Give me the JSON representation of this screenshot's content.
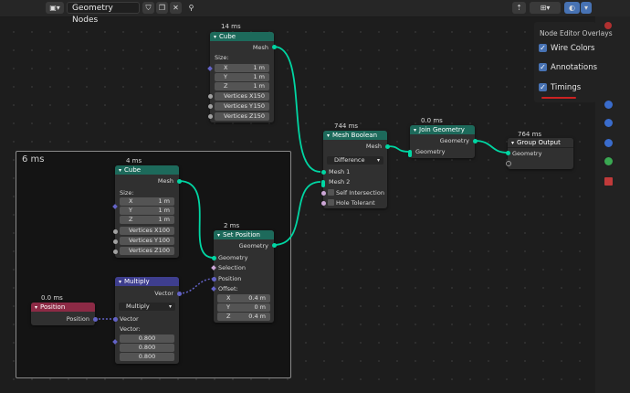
{
  "header": {
    "editor_type_icon": "node-editor-icon",
    "tree_name": "Geometry Nodes",
    "fake_user_icon": "shield-icon",
    "copy_icon": "duplicate-icon",
    "delete_icon": "x-icon",
    "pin_icon": "pin-icon"
  },
  "overlays": {
    "title": "Node Editor Overlays",
    "items": [
      {
        "label": "Wire Colors",
        "checked": true
      },
      {
        "label": "Annotations",
        "checked": true
      },
      {
        "label": "Timings",
        "checked": true
      }
    ],
    "check_mark": "✓",
    "accent_color": "#4772b3",
    "underline_color": "#cc2222"
  },
  "frame": {
    "label": "6 ms"
  },
  "nodes": {
    "cube_top": {
      "timing": "14 ms",
      "title": "Cube",
      "output": "Mesh",
      "size_label": "Size:",
      "fields": [
        {
          "label": "X",
          "value": "1 m"
        },
        {
          "label": "Y",
          "value": "1 m"
        },
        {
          "label": "Z",
          "value": "1 m"
        },
        {
          "label": "Vertices X",
          "value": "150"
        },
        {
          "label": "Vertices Y",
          "value": "150"
        },
        {
          "label": "Vertices Z",
          "value": "150"
        }
      ]
    },
    "cube_frame": {
      "timing": "4 ms",
      "title": "Cube",
      "output": "Mesh",
      "size_label": "Size:",
      "fields": [
        {
          "label": "X",
          "value": "1 m"
        },
        {
          "label": "Y",
          "value": "1 m"
        },
        {
          "label": "Z",
          "value": "1 m"
        },
        {
          "label": "Vertices X",
          "value": "100"
        },
        {
          "label": "Vertices Y",
          "value": "100"
        },
        {
          "label": "Vertices Z",
          "value": "100"
        }
      ]
    },
    "mesh_boolean": {
      "timing": "744 ms",
      "title": "Mesh Boolean",
      "output": "Mesh",
      "operation": "Difference",
      "inputs": [
        "Mesh 1",
        "Mesh 2",
        "Self Intersection",
        "Hole Tolerant"
      ]
    },
    "join_geometry": {
      "timing": "0.0 ms",
      "title": "Join Geometry",
      "output": "Geometry",
      "input": "Geometry"
    },
    "group_output": {
      "timing": "764 ms",
      "title": "Group Output",
      "input": "Geometry"
    },
    "set_position": {
      "timing": "2 ms",
      "title": "Set Position",
      "output": "Geometry",
      "inputs": [
        "Geometry",
        "Selection",
        "Position"
      ],
      "offset_label": "Offset:",
      "fields": [
        {
          "label": "X",
          "value": "0.4 m"
        },
        {
          "label": "Y",
          "value": "0 m"
        },
        {
          "label": "Z",
          "value": "0.4 m"
        }
      ]
    },
    "multiply": {
      "title": "Multiply",
      "output": "Vector",
      "operation": "Multiply",
      "input": "Vector",
      "vector_label": "Vector:",
      "values": [
        "0.800",
        "0.800",
        "0.800"
      ]
    },
    "position": {
      "timing": "0.0 ms",
      "title": "Position",
      "output": "Position"
    }
  },
  "sidebar_icons": [
    "view-icon",
    "item-icon",
    "tool-icon",
    "node-icon",
    "options-icon",
    "grid-icon"
  ],
  "header_right_icons": [
    "parent-tree-icon",
    "snap-icon",
    "overlay-icon",
    "overlay-dropdown-icon"
  ],
  "socket_colors": {
    "geometry": "#00d6a3",
    "vector": "#6363c7",
    "float": "#a1a1a1",
    "boolean": "#cca6d6"
  },
  "header_colors": {
    "geometry": "#1d6a5b",
    "input": "#8c2a45",
    "vector": "#3e3e8e"
  }
}
